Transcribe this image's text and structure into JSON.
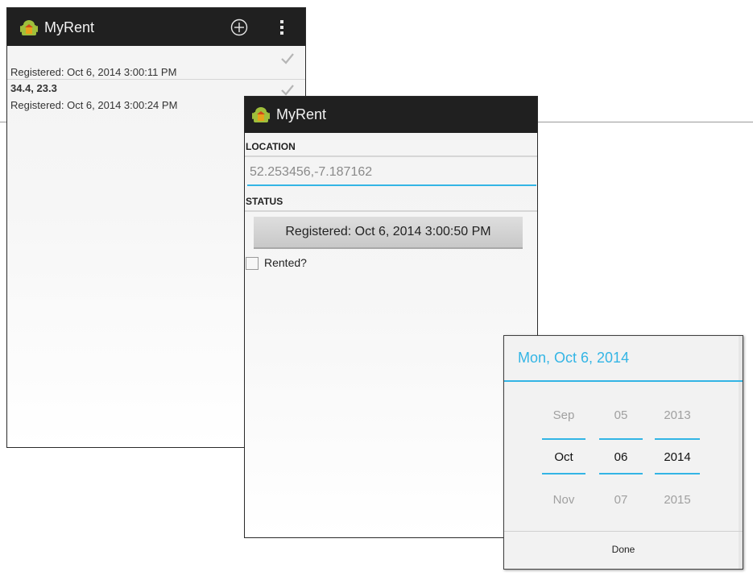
{
  "app": {
    "title": "MyRent",
    "accent_color": "#33b5e5",
    "actionbar_color": "#202020"
  },
  "list_screen": {
    "actions": {
      "add_icon": "add-circle-icon",
      "overflow_icon": "overflow-menu-icon"
    },
    "items": [
      {
        "title": "",
        "subtitle": "Registered: Oct 6, 2014 3:00:11 PM",
        "checked": true
      },
      {
        "title": "34.4, 23.3",
        "subtitle": "Registered: Oct 6, 2014 3:00:24 PM",
        "checked": true
      }
    ]
  },
  "detail_screen": {
    "location_label": "LOCATION",
    "location_value": "52.253456,-7.187162",
    "status_label": "STATUS",
    "date_button": "Registered: Oct 6, 2014 3:00:50 PM",
    "rented_label": "Rented?",
    "rented_checked": false
  },
  "date_picker": {
    "title": "Mon, Oct 6, 2014",
    "month": {
      "prev": "Sep",
      "current": "Oct",
      "next": "Nov"
    },
    "day": {
      "prev": "05",
      "current": "06",
      "next": "07"
    },
    "year": {
      "prev": "2013",
      "current": "2014",
      "next": "2015"
    },
    "done_label": "Done"
  }
}
